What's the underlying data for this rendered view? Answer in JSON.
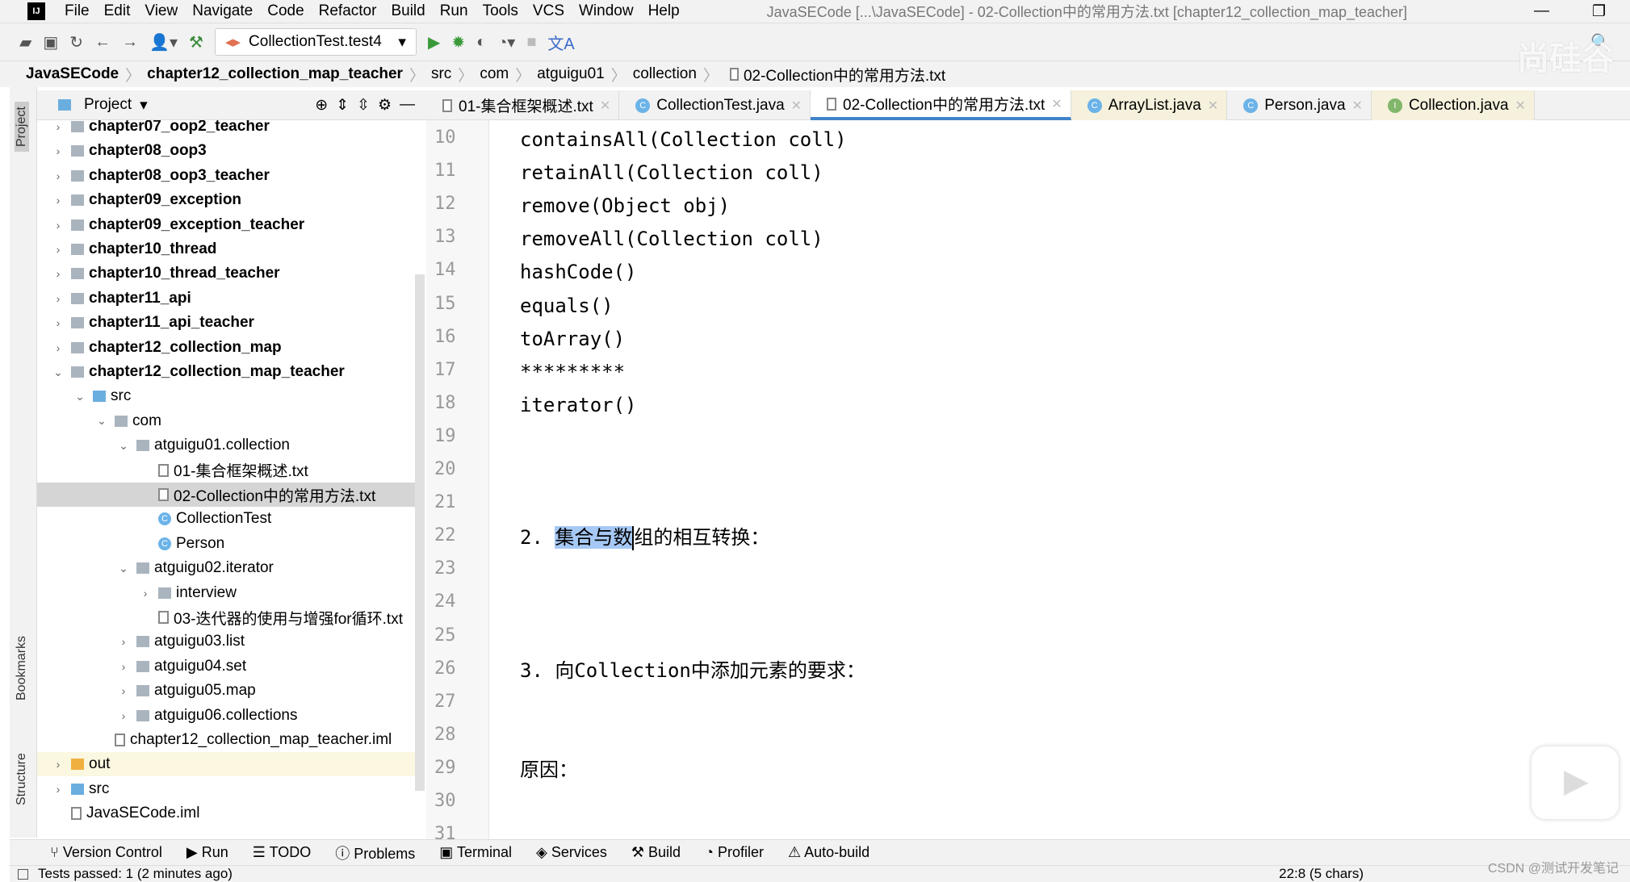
{
  "menu": {
    "items": [
      "File",
      "Edit",
      "View",
      "Navigate",
      "Code",
      "Refactor",
      "Build",
      "Run",
      "Tools",
      "VCS",
      "Window",
      "Help"
    ],
    "title": "JavaSECode [...\\JavaSECode] - 02-Collection中的常用方法.txt [chapter12_collection_map_teacher]"
  },
  "toolbar": {
    "run_config": "CollectionTest.test4"
  },
  "breadcrumb": [
    "JavaSECode",
    "chapter12_collection_map_teacher",
    "src",
    "com",
    "atguigu01",
    "collection",
    "02-Collection中的常用方法.txt"
  ],
  "left_stripe": {
    "project": "Project",
    "bookmarks": "Bookmarks",
    "structure": "Structure"
  },
  "project_panel": {
    "title": "Project"
  },
  "tree": [
    {
      "label": "chapter07_oop2_teacher",
      "depth": 0,
      "icon": "module-folder",
      "arrow": "right",
      "bold": true
    },
    {
      "label": "chapter08_oop3",
      "depth": 0,
      "icon": "module-folder",
      "arrow": "right",
      "bold": true
    },
    {
      "label": "chapter08_oop3_teacher",
      "depth": 0,
      "icon": "module-folder",
      "arrow": "right",
      "bold": true
    },
    {
      "label": "chapter09_exception",
      "depth": 0,
      "icon": "module-folder",
      "arrow": "right",
      "bold": true
    },
    {
      "label": "chapter09_exception_teacher",
      "depth": 0,
      "icon": "module-folder",
      "arrow": "right",
      "bold": true
    },
    {
      "label": "chapter10_thread",
      "depth": 0,
      "icon": "module-folder",
      "arrow": "right",
      "bold": true
    },
    {
      "label": "chapter10_thread_teacher",
      "depth": 0,
      "icon": "module-folder",
      "arrow": "right",
      "bold": true
    },
    {
      "label": "chapter11_api",
      "depth": 0,
      "icon": "module-folder",
      "arrow": "right",
      "bold": true
    },
    {
      "label": "chapter11_api_teacher",
      "depth": 0,
      "icon": "module-folder",
      "arrow": "right",
      "bold": true
    },
    {
      "label": "chapter12_collection_map",
      "depth": 0,
      "icon": "module-folder",
      "arrow": "right",
      "bold": true
    },
    {
      "label": "chapter12_collection_map_teacher",
      "depth": 0,
      "icon": "module-folder",
      "arrow": "down",
      "bold": true
    },
    {
      "label": "src",
      "depth": 1,
      "icon": "src-folder",
      "arrow": "down"
    },
    {
      "label": "com",
      "depth": 2,
      "icon": "folder",
      "arrow": "down"
    },
    {
      "label": "atguigu01.collection",
      "depth": 3,
      "icon": "folder",
      "arrow": "down"
    },
    {
      "label": "01-集合框架概述.txt",
      "depth": 4,
      "icon": "text-file",
      "arrow": ""
    },
    {
      "label": "02-Collection中的常用方法.txt",
      "depth": 4,
      "icon": "text-file",
      "arrow": "",
      "selected": true
    },
    {
      "label": "CollectionTest",
      "depth": 4,
      "icon": "class",
      "arrow": ""
    },
    {
      "label": "Person",
      "depth": 4,
      "icon": "class",
      "arrow": ""
    },
    {
      "label": "atguigu02.iterator",
      "depth": 3,
      "icon": "folder",
      "arrow": "down"
    },
    {
      "label": "interview",
      "depth": 4,
      "icon": "folder",
      "arrow": "right"
    },
    {
      "label": "03-迭代器的使用与增强for循环.txt",
      "depth": 4,
      "icon": "text-file",
      "arrow": ""
    },
    {
      "label": "atguigu03.list",
      "depth": 3,
      "icon": "folder",
      "arrow": "right"
    },
    {
      "label": "atguigu04.set",
      "depth": 3,
      "icon": "folder",
      "arrow": "right"
    },
    {
      "label": "atguigu05.map",
      "depth": 3,
      "icon": "folder",
      "arrow": "right"
    },
    {
      "label": "atguigu06.collections",
      "depth": 3,
      "icon": "folder",
      "arrow": "right"
    },
    {
      "label": "chapter12_collection_map_teacher.iml",
      "depth": 2,
      "icon": "iml-file",
      "arrow": ""
    },
    {
      "label": "out",
      "depth": 0,
      "icon": "out-folder",
      "arrow": "right",
      "out": true
    },
    {
      "label": "src",
      "depth": 0,
      "icon": "src-folder",
      "arrow": "right"
    },
    {
      "label": "JavaSECode.iml",
      "depth": 0,
      "icon": "iml-file",
      "arrow": ""
    }
  ],
  "tabs": [
    {
      "label": "01-集合框架概述.txt",
      "icon": "text-file"
    },
    {
      "label": "CollectionTest.java",
      "icon": "class"
    },
    {
      "label": "02-Collection中的常用方法.txt",
      "icon": "text-file",
      "active": true
    },
    {
      "label": "ArrayList.java",
      "icon": "class",
      "yellow": true
    },
    {
      "label": "Person.java",
      "icon": "class"
    },
    {
      "label": "Collection.java",
      "icon": "interface",
      "yellow": true
    }
  ],
  "editor": {
    "lines": [
      {
        "n": "10",
        "text": "containsAll(Collection coll)"
      },
      {
        "n": "11",
        "text": "retainAll(Collection coll)"
      },
      {
        "n": "12",
        "text": "remove(Object obj)"
      },
      {
        "n": "13",
        "text": "removeAll(Collection coll)"
      },
      {
        "n": "14",
        "text": "hashCode()"
      },
      {
        "n": "15",
        "text": "equals()"
      },
      {
        "n": "16",
        "text": "toArray()"
      },
      {
        "n": "17",
        "text": "*********"
      },
      {
        "n": "18",
        "text": "iterator()"
      },
      {
        "n": "19",
        "text": ""
      },
      {
        "n": "20",
        "text": ""
      },
      {
        "n": "21",
        "text": ""
      },
      {
        "n": "22",
        "text": ""
      },
      {
        "n": "23",
        "text": ""
      },
      {
        "n": "24",
        "text": ""
      },
      {
        "n": "25",
        "text": ""
      },
      {
        "n": "26",
        "text": "3. 向Collection中添加元素的要求："
      },
      {
        "n": "27",
        "text": ""
      },
      {
        "n": "28",
        "text": ""
      },
      {
        "n": "29",
        "text": "原因："
      },
      {
        "n": "30",
        "text": ""
      },
      {
        "n": "31",
        "text": ""
      }
    ],
    "line22": {
      "prefix": "2. ",
      "selected": "集合与数",
      "rest": "组的相互转换："
    }
  },
  "bottom_tools": [
    "Version Control",
    "Run",
    "TODO",
    "Problems",
    "Terminal",
    "Services",
    "Build",
    "Profiler",
    "Auto-build"
  ],
  "status": {
    "tests": "Tests passed: 1 (2 minutes ago)",
    "position": "22:8 (5 chars)"
  },
  "watermark": {
    "text": "尚硅谷",
    "csdn": "CSDN @测试开发笔记"
  },
  "colors": {
    "accent": "#4083c9",
    "selection": "#a6c8f5",
    "current_line": "#fdf6e8"
  }
}
